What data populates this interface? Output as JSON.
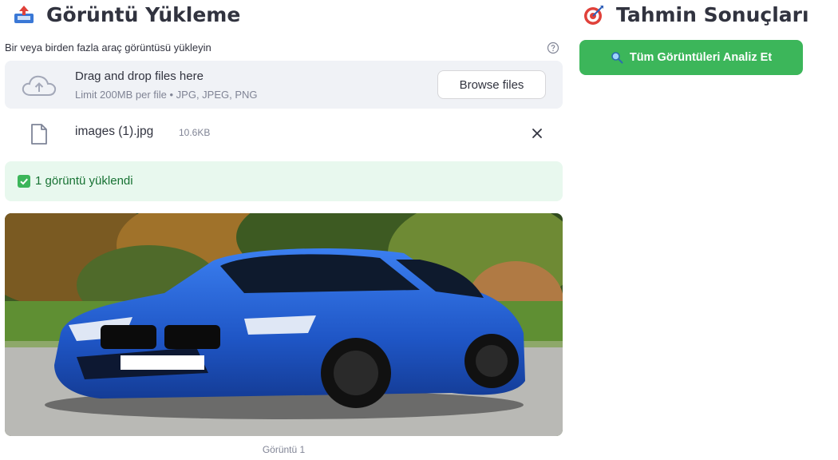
{
  "upload_section": {
    "title": "Görüntü Yükleme",
    "title_icon": "inbox-tray-icon",
    "uploader_label": "Bir veya birden fazla araç görüntüsü yükleyin",
    "dropzone": {
      "main_text": "Drag and drop files here",
      "sub_text": "Limit 200MB per file • JPG, JPEG, PNG",
      "browse_label": "Browse files"
    },
    "file": {
      "name": "images (1).jpg",
      "size": "10.6KB"
    },
    "success_message": "1 görüntü yüklendi",
    "image_caption": "Görüntü 1"
  },
  "results_section": {
    "title": "Tahmin Sonuçları",
    "title_icon": "target-icon",
    "analyze_button_label": "Tüm Görüntüleri Analiz Et"
  },
  "colors": {
    "primary_green": "#3cb65a",
    "success_bg": "#e8f8ee",
    "success_text": "#177233",
    "dropzone_bg": "#f0f2f6",
    "car_blue": "#1f56c6"
  }
}
